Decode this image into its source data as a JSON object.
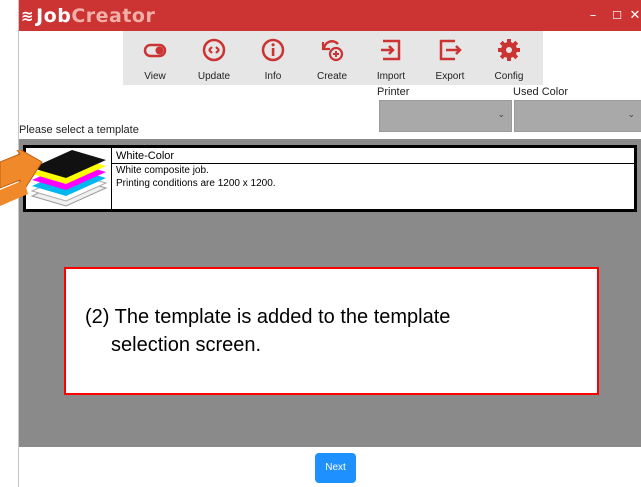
{
  "app": {
    "brand_job": "Job",
    "brand_creator": "Creator",
    "accent_color": "#cc3333"
  },
  "window_controls": {
    "minimize": "–",
    "maximize": "☐",
    "close": "✕"
  },
  "toolbar": {
    "items": [
      {
        "label": "View",
        "icon": "toggle-icon"
      },
      {
        "label": "Update",
        "icon": "update-icon"
      },
      {
        "label": "Info",
        "icon": "info-icon"
      },
      {
        "label": "Create",
        "icon": "create-icon"
      },
      {
        "label": "Import",
        "icon": "import-icon"
      },
      {
        "label": "Export",
        "icon": "export-icon"
      },
      {
        "label": "Config",
        "icon": "gear-icon"
      }
    ]
  },
  "filters": {
    "printer_label": "Printer",
    "printer_value": "",
    "used_color_label": "Used Color",
    "used_color_value": ""
  },
  "prompt": "Please select a template",
  "templates": [
    {
      "name": "White-Color",
      "description_line1": "White composite job.",
      "description_line2": "Printing conditions are 1200 x 1200."
    }
  ],
  "callout": {
    "line1": "(2) The template is added to the template",
    "line2": "selection screen."
  },
  "footer": {
    "next_label": "Next"
  }
}
